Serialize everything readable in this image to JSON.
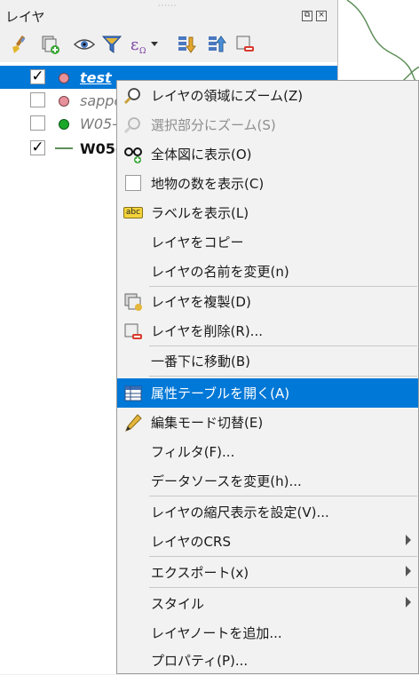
{
  "panel": {
    "title": "レイヤ",
    "float_glyph": "⧉",
    "close_glyph": "×"
  },
  "toolbar": {
    "icons": [
      "style-brush-icon",
      "add-group-icon",
      "visibility-eye-icon",
      "filter-legend-icon",
      "expression-filter-icon",
      "expand-all-icon",
      "collapse-all-icon",
      "remove-layer-icon"
    ]
  },
  "layers": [
    {
      "name": "test",
      "checked": true,
      "check_glyph": "✓",
      "symbol": "circle",
      "color": "#e7919b",
      "selected": true
    },
    {
      "name": "sappo",
      "checked": false,
      "check_glyph": "",
      "symbol": "circle",
      "color": "#e7919b",
      "selected": false
    },
    {
      "name": "W05-",
      "checked": false,
      "check_glyph": "",
      "symbol": "circle",
      "color": "#19a829",
      "selected": false
    },
    {
      "name": "W05-",
      "checked": true,
      "check_glyph": "✓",
      "symbol": "line",
      "color": "#5f8f5a",
      "selected": false
    }
  ],
  "menu": {
    "items": [
      {
        "label": "レイヤの領域にズーム(Z)",
        "icon": "zoom-to-layer-icon"
      },
      {
        "label": "選択部分にズーム(S)",
        "icon": "zoom-to-selection-icon",
        "disabled": true
      },
      {
        "label": "全体図に表示(O)",
        "icon": "show-in-overview-icon"
      },
      {
        "label": "地物の数を表示(C)",
        "icon": "feature-count-checkbox-icon"
      },
      {
        "label": "ラベルを表示(L)",
        "icon": "label-abc-icon",
        "icon_text": "abc"
      },
      {
        "label": "レイヤをコピー"
      },
      {
        "label": "レイヤの名前を変更(n)"
      },
      {
        "label": "レイヤを複製(D)",
        "icon": "duplicate-layer-icon"
      },
      {
        "label": "レイヤを削除(R)...",
        "icon": "remove-layer-icon"
      },
      {
        "label": "一番下に移動(B)"
      },
      {
        "label": "属性テーブルを開く(A)",
        "icon": "attribute-table-icon",
        "highlighted": true
      },
      {
        "label": "編集モード切替(E)",
        "icon": "toggle-editing-pencil-icon"
      },
      {
        "label": "フィルタ(F)..."
      },
      {
        "label": "データソースを変更(h)..."
      },
      {
        "label": "レイヤの縮尺表示を設定(V)..."
      },
      {
        "label": "レイヤのCRS",
        "submenu": true
      },
      {
        "label": "エクスポート(x)",
        "submenu": true
      },
      {
        "label": "スタイル",
        "submenu": true
      },
      {
        "label": "レイヤノートを追加..."
      },
      {
        "label": "プロパティ(P)..."
      }
    ]
  }
}
